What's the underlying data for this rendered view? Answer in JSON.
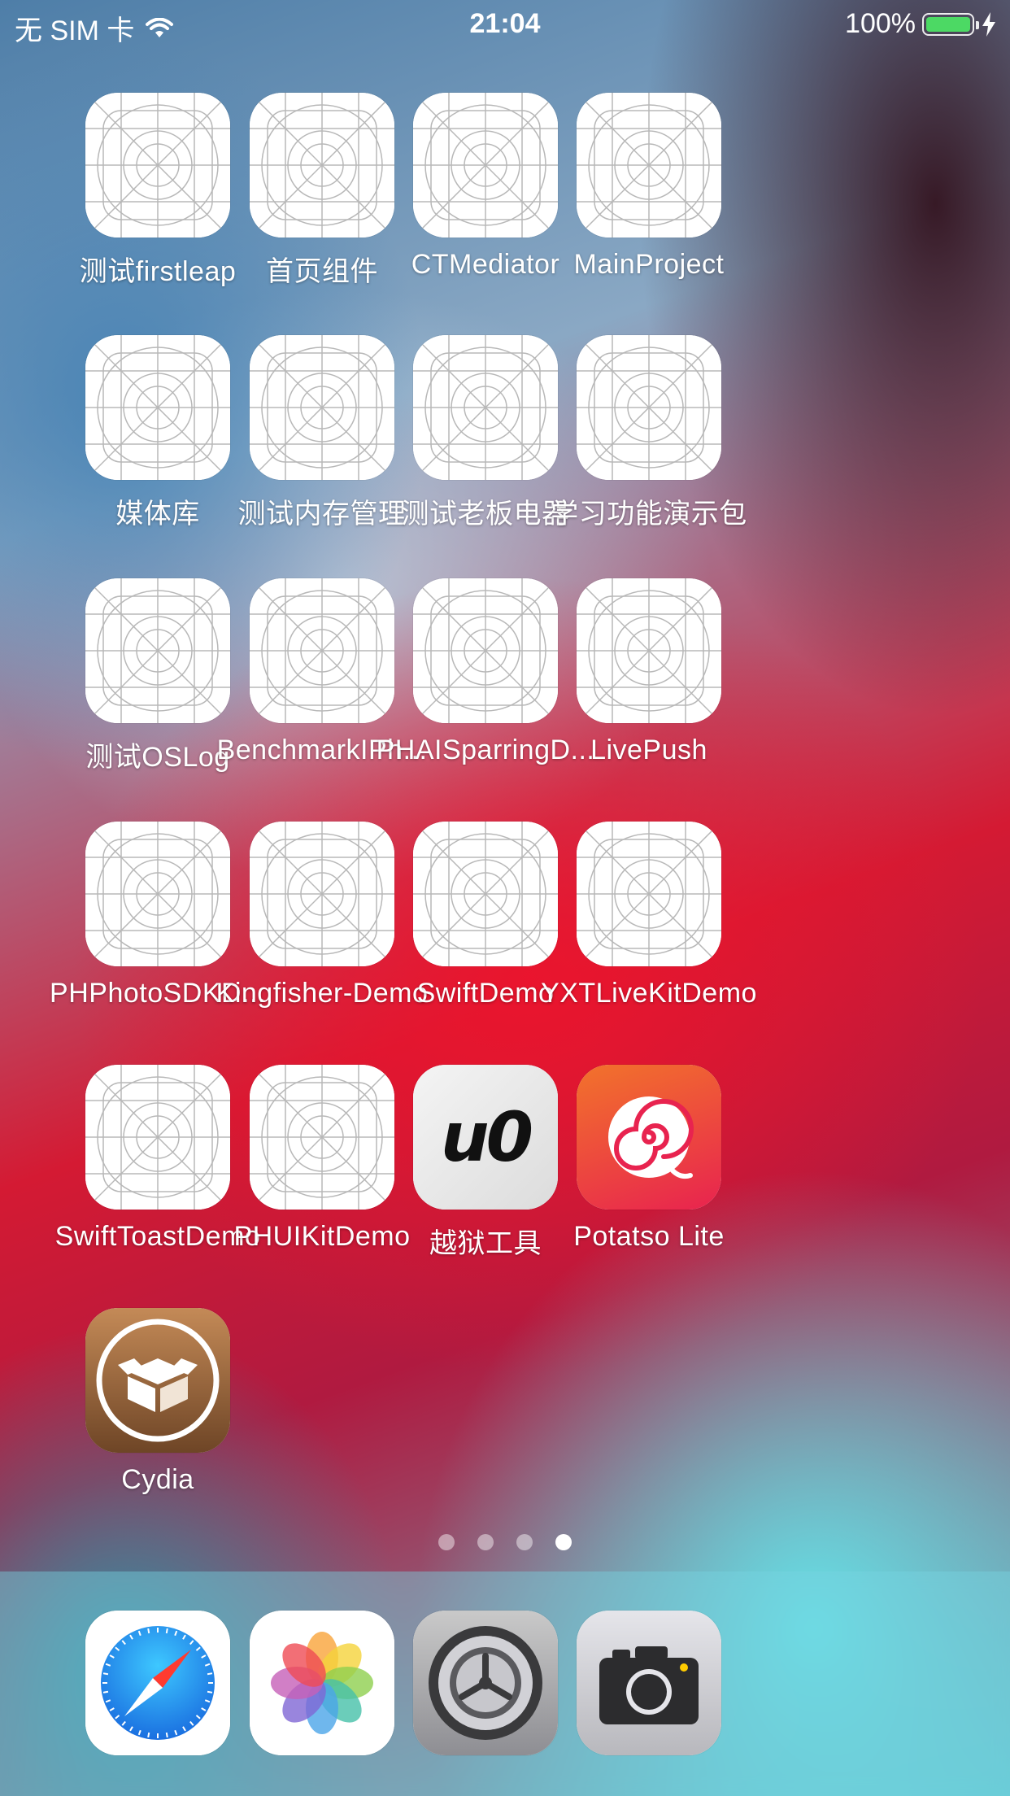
{
  "status_bar": {
    "carrier": "无 SIM 卡",
    "time": "21:04",
    "battery": "100%",
    "battery_level": 1.0
  },
  "apps": [
    {
      "label": "测试firstleap",
      "icon": "placeholder-app-icon"
    },
    {
      "label": "首页组件",
      "icon": "placeholder-app-icon"
    },
    {
      "label": "CTMediator",
      "icon": "placeholder-app-icon"
    },
    {
      "label": "MainProject",
      "icon": "placeholder-app-icon"
    },
    {
      "label": "媒体库",
      "icon": "placeholder-app-icon"
    },
    {
      "label": "测试内存管理",
      "icon": "placeholder-app-icon"
    },
    {
      "label": "测试老板电器",
      "icon": "placeholder-app-icon"
    },
    {
      "label": "学习功能演示包",
      "icon": "placeholder-app-icon"
    },
    {
      "label": "测试OSLog",
      "icon": "placeholder-app-icon"
    },
    {
      "label": "BenchmarkIPh...",
      "icon": "placeholder-app-icon"
    },
    {
      "label": "PHAISparringD...",
      "icon": "placeholder-app-icon"
    },
    {
      "label": "LivePush",
      "icon": "placeholder-app-icon"
    },
    {
      "label": "PHPhotoSDKD...",
      "icon": "placeholder-app-icon"
    },
    {
      "label": "Kingfisher-Demo",
      "icon": "placeholder-app-icon"
    },
    {
      "label": "SwiftDemo",
      "icon": "placeholder-app-icon"
    },
    {
      "label": "YXTLiveKitDemo",
      "icon": "placeholder-app-icon"
    },
    {
      "label": "SwiftToastDemo",
      "icon": "placeholder-app-icon"
    },
    {
      "label": "PHUIKitDemo",
      "icon": "placeholder-app-icon"
    },
    {
      "label": "越狱工具",
      "icon": "unc0ver-icon",
      "icon_text": "u0"
    },
    {
      "label": "Potatso Lite",
      "icon": "potatso-spiral-icon"
    },
    {
      "label": "Cydia",
      "icon": "cydia-box-icon"
    }
  ],
  "page_dots": {
    "count": 4,
    "active_index": 3
  },
  "dock": [
    {
      "name": "safari",
      "icon": "safari-compass-icon"
    },
    {
      "name": "photos",
      "icon": "photos-flower-icon"
    },
    {
      "name": "settings",
      "icon": "settings-gear-icon"
    },
    {
      "name": "camera",
      "icon": "camera-icon"
    }
  ],
  "colors": {
    "battery_fill": "#4cd964",
    "potatso_bg": "#e8234f",
    "cydia_bg": "#9b6a3f"
  }
}
